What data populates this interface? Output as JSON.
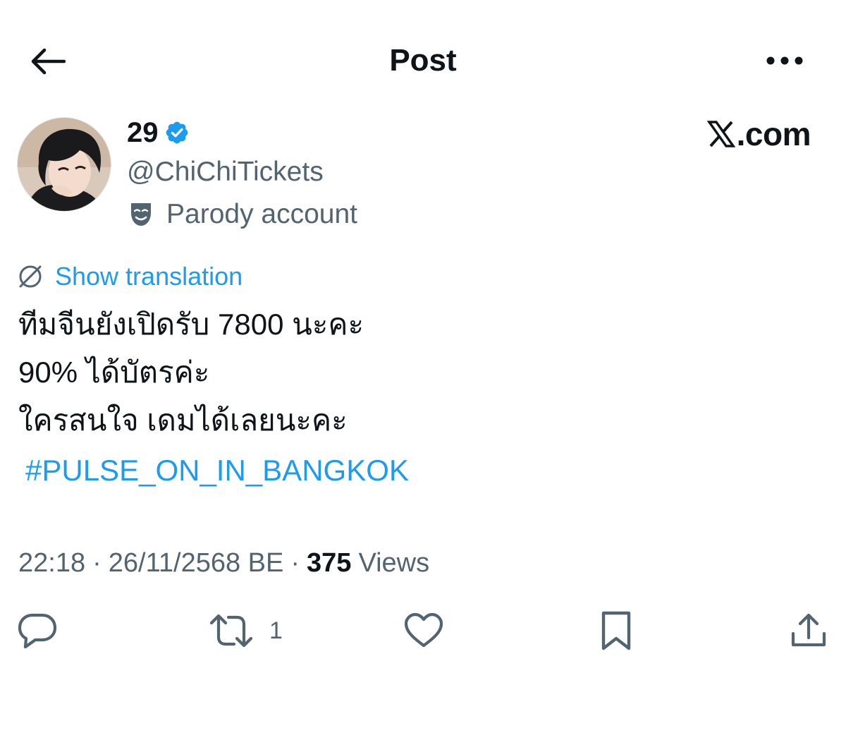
{
  "header": {
    "title": "Post",
    "back_icon": "arrow-left-icon",
    "more_icon": "more-horizontal-icon"
  },
  "author": {
    "display_name": "29",
    "verified": true,
    "handle": "@ChiChiTickets",
    "label": "Parody account",
    "label_icon": "theater-masks-icon",
    "avatar_icon": "avatar-icon"
  },
  "brand": {
    "text": ".com",
    "icon": "x-logo-icon"
  },
  "translation": {
    "label": "Show translation",
    "icon": "translate-icon"
  },
  "post": {
    "lines": [
      "ทีมจีนยังเปิดรับ 7800 นะคะ",
      "90% ได้บัตรค่ะ",
      "ใครสนใจ เดมได้เลยนะคะ"
    ],
    "hashtag": "#PULSE_ON_IN_BANGKOK"
  },
  "meta": {
    "time": "22:18",
    "date": "26/11/2568 BE",
    "separator": "·",
    "views_count": "375",
    "views_label": "Views"
  },
  "actions": {
    "reply_icon": "reply-icon",
    "repost_icon": "repost-icon",
    "repost_count": "1",
    "like_icon": "heart-icon",
    "bookmark_icon": "bookmark-icon",
    "share_icon": "share-icon"
  },
  "colors": {
    "accent": "#1d9bf0",
    "text_primary": "#0f1419",
    "text_secondary": "#536471",
    "icon": "#536471"
  }
}
